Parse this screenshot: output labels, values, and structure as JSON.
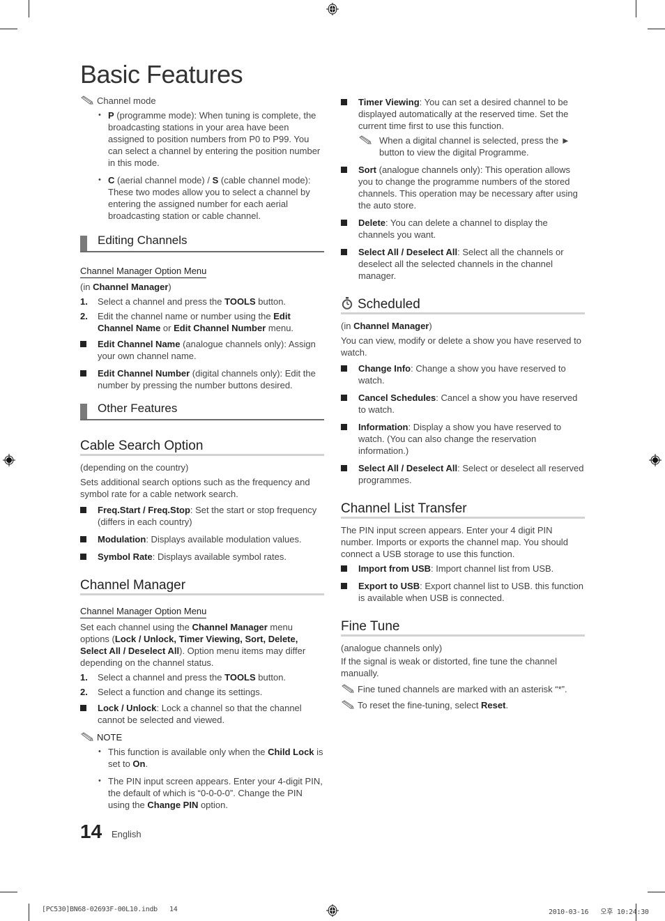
{
  "page": {
    "title": "Basic Features",
    "page_number": "14",
    "language": "English",
    "slug_left": "[PC530]BN68-02693F-00L10.indb   14",
    "slug_right": "2010-03-16   오후 10:24:30"
  },
  "left": {
    "channel_mode": {
      "note_label": "Channel mode",
      "items": [
        {
          "bold": "P",
          "text": " (programme mode): When tuning is complete, the broadcasting stations in your area have been assigned to position numbers from P0 to P99. You can select a channel by entering the position number in this mode."
        },
        {
          "bold": "C",
          "text": " (aerial channel mode) / ",
          "bold2": "S",
          "text2": " (cable channel mode): These two modes allow you to select a channel by entering the assigned number for each aerial broadcasting station or cable channel."
        }
      ]
    },
    "editing_channels": {
      "heading": "Editing Channels",
      "sub_heading": "Channel Manager Option Menu",
      "context_pre": "(in ",
      "context_bold": "Channel Manager",
      "context_post": ")",
      "steps": [
        {
          "n": "1.",
          "pre": "Select a channel and press the ",
          "bold": "TOOLS",
          "post": " button."
        },
        {
          "n": "2.",
          "pre": "Edit the channel name or number using the ",
          "bold": "Edit Channel Name",
          "mid": " or ",
          "bold2": "Edit Channel Number",
          "post": " menu."
        }
      ],
      "items": [
        {
          "bold": "Edit Channel Name",
          "text": " (analogue channels only): Assign your own channel name."
        },
        {
          "bold": "Edit Channel Number",
          "text": " (digital channels only): Edit the number by pressing the number buttons desired."
        }
      ]
    },
    "other_features": {
      "heading": "Other Features"
    },
    "cable_search": {
      "heading": "Cable Search Option",
      "condition": "(depending on the country)",
      "description": "Sets additional search options such as the frequency and symbol rate for a cable network search.",
      "items": [
        {
          "bold": "Freq.Start / Freq.Stop",
          "text": ": Set the start or stop frequency (differs in each country)"
        },
        {
          "bold": "Modulation",
          "text": ": Displays available modulation values."
        },
        {
          "bold": "Symbol Rate",
          "text": ": Displays available symbol rates."
        }
      ]
    },
    "channel_manager": {
      "heading": "Channel Manager",
      "sub_heading": "Channel Manager Option Menu",
      "desc_pre": "Set each channel using the ",
      "desc_bold": "Channel Manager",
      "desc_mid": " menu options (",
      "desc_bold2": "Lock / Unlock, Timer Viewing, Sort, Delete, Select All / Deselect All",
      "desc_post": "). Option menu items may differ depending on the channel status.",
      "steps": [
        {
          "n": "1.",
          "pre": "Select a channel and press the ",
          "bold": "TOOLS",
          "post": " button."
        },
        {
          "n": "2.",
          "pre": "Select a function and change its settings.",
          "bold": "",
          "post": ""
        }
      ],
      "items": [
        {
          "bold": "Lock / Unlock",
          "text": ": Lock a channel so that the channel cannot be selected and viewed."
        }
      ],
      "note_label": "NOTE",
      "notes": [
        {
          "pre": "This function is available only when the ",
          "bold": "Child Lock",
          "mid": " is set to ",
          "bold2": "On",
          "post": "."
        },
        {
          "pre": "The PIN input screen appears. Enter your 4-digit PIN, the default of which is “0-0-0-0”. Change the PIN using the ",
          "bold": "Change PIN",
          "mid": " option.",
          "bold2": "",
          "post": ""
        }
      ]
    }
  },
  "right": {
    "channel_manager_items": [
      {
        "bold": "Timer Viewing",
        "text": ": You can set a desired channel to be displayed automatically at the reserved time. Set the current time first to use this function.",
        "sub_note": "When a digital channel is selected, press the ► button to view the digital Programme."
      },
      {
        "bold": "Sort",
        "text": " (analogue channels only): This operation allows you to change the programme numbers of the stored channels. This operation may be necessary after using the auto store.",
        "sub_note": ""
      },
      {
        "bold": "Delete",
        "text": ": You can delete a channel to display the channels you want.",
        "sub_note": ""
      },
      {
        "bold": "Select All / Deselect All",
        "text": ": Select all the channels or deselect all the selected channels in the channel manager.",
        "sub_note": ""
      }
    ],
    "scheduled": {
      "heading": "Scheduled",
      "icon": "clock-icon",
      "context_pre": "(in ",
      "context_bold": "Channel Manager",
      "context_post": ")",
      "description": "You can view, modify or delete a show you have reserved to watch.",
      "items": [
        {
          "bold": "Change Info",
          "text": ": Change a show you have reserved to watch."
        },
        {
          "bold": "Cancel Schedules",
          "text": ": Cancel a show you have reserved to watch."
        },
        {
          "bold": "Information",
          "text": ": Display a show you have reserved to watch. (You can also change the reservation information.)"
        },
        {
          "bold": "Select All / Deselect All",
          "text": ": Select or deselect all reserved programmes."
        }
      ]
    },
    "channel_list_transfer": {
      "heading": "Channel List Transfer",
      "description": "The PIN input screen appears. Enter your 4 digit PIN number. Imports or exports the channel map. You should connect a USB storage to use this function.",
      "items": [
        {
          "bold": "Import from USB",
          "text": ": Import channel list from USB."
        },
        {
          "bold": "Export to USB",
          "text": ": Export channel list to USB. this function is available when USB is connected."
        }
      ]
    },
    "fine_tune": {
      "heading": "Fine Tune",
      "condition": "(analogue channels only)",
      "description": "If the signal is weak or distorted, fine tune the channel manually.",
      "notes": [
        {
          "pre": "Fine tuned channels are marked with an asterisk “*”.",
          "bold": "",
          "post": ""
        },
        {
          "pre": "To reset the fine-tuning, select ",
          "bold": "Reset",
          "post": "."
        }
      ]
    }
  }
}
